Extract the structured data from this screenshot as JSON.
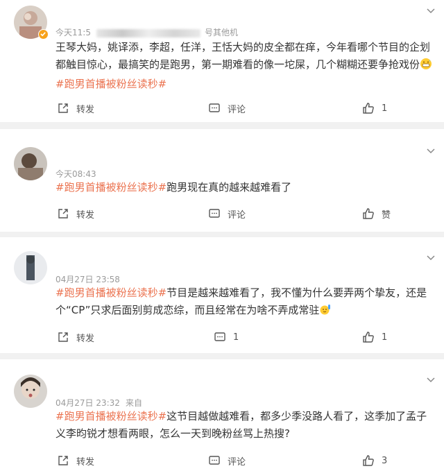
{
  "posts": [
    {
      "time": "今天11:5",
      "source": "号其他机",
      "text_pre": "王琴大妈，姚译添，李超，任洋，王恬大妈的皮全都在痒，今年看哪个节目的企划都触目惊心，最搞笑的是跑男，第一期难看的像一坨屎，几个糊糊还要争抢戏份",
      "hashtag": "#跑男首播被粉丝读秒#",
      "text_post": "",
      "emoji": "grin-sweat-emoji",
      "share_label": "转发",
      "comment_label": "评论",
      "like_label": "1",
      "verified": true
    },
    {
      "time": "今天08:43",
      "source": "",
      "hashtag": "#跑男首播被粉丝读秒#",
      "text_post": "跑男现在真的越来越难看了",
      "share_label": "转发",
      "comment_label": "评论",
      "like_label": "赞"
    },
    {
      "time": "04月27日 23:58",
      "source": "",
      "hashtag": "#跑男首播被粉丝读秒#",
      "text_post": "节目是越来越难看了，我不懂为什么要弄两个挚友，还是个“CP”只求后面别剪成恋综，而且经常在为啥不弄成常驻",
      "emoji": "raising-hand-emoji",
      "share_label": "转发",
      "comment_label": "1",
      "like_label": "1"
    },
    {
      "time": "04月27日 23:32",
      "source": "来自",
      "hashtag": "#跑男首播被粉丝读秒#",
      "text_post": "这节目越做越难看，都多少季没路人看了，这季加了孟子义李昀锐才想看两眼，怎么一天到晚粉丝骂上热搜?",
      "share_label": "转发",
      "comment_label": "评论",
      "like_label": "3"
    }
  ],
  "colors": {
    "hashtag": "#eb7350",
    "meta": "#9a9a9a",
    "text": "#333333",
    "divider": "#f1f1f1",
    "verified": "#f7a21c"
  },
  "icons": [
    "share-icon",
    "comment-icon",
    "like-icon",
    "chevron-down-icon",
    "verified-icon"
  ]
}
